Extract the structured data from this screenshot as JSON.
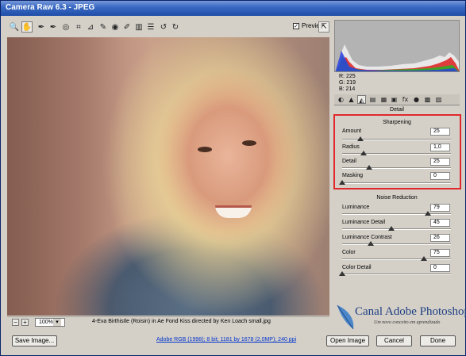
{
  "window": {
    "title": "Camera Raw 6.3  -  JPEG"
  },
  "toolbar": {
    "tools": [
      {
        "name": "zoom-tool-icon",
        "glyph": "🔍"
      },
      {
        "name": "hand-tool-icon",
        "glyph": "✋"
      },
      {
        "name": "white-balance-tool-icon",
        "glyph": "✒"
      },
      {
        "name": "color-sampler-tool-icon",
        "glyph": "✒"
      },
      {
        "name": "targeted-adjustment-tool-icon",
        "glyph": "◎"
      },
      {
        "name": "crop-tool-icon",
        "glyph": "⌗"
      },
      {
        "name": "straighten-tool-icon",
        "glyph": "⊿"
      },
      {
        "name": "spot-removal-tool-icon",
        "glyph": "✎"
      },
      {
        "name": "red-eye-tool-icon",
        "glyph": "◉"
      },
      {
        "name": "adjustment-brush-icon",
        "glyph": "✐"
      },
      {
        "name": "graduated-filter-icon",
        "glyph": "▥"
      },
      {
        "name": "preferences-icon",
        "glyph": "☰"
      },
      {
        "name": "rotate-left-icon",
        "glyph": "↺"
      },
      {
        "name": "rotate-right-icon",
        "glyph": "↻"
      }
    ],
    "preview_label": "Preview",
    "preview_checked": "✓",
    "fullscreen_glyph": "⇱"
  },
  "status": {
    "zoom_out_glyph": "−",
    "zoom_in_glyph": "+",
    "zoom": "100%",
    "zoom_drop_glyph": "▾",
    "filename": "4-Eva Birthistle (Roisin) in Ae Fond Kiss directed by Ken Loach small.jpg"
  },
  "readout": {
    "r": "R:  225",
    "g": "G:  219",
    "b": "B:  214"
  },
  "panel": {
    "title": "Detail",
    "tabs": [
      "◐",
      "▲",
      "◭",
      "▤",
      "▦",
      "▣",
      "fx",
      "●",
      "▩",
      "▨"
    ],
    "sharpening": {
      "title": "Sharpening",
      "sliders": [
        {
          "label": "Amount",
          "value": "25",
          "fraction": 0.17
        },
        {
          "label": "Radius",
          "value": "1,0",
          "fraction": 0.2
        },
        {
          "label": "Detail",
          "value": "25",
          "fraction": 0.25
        },
        {
          "label": "Masking",
          "value": "0",
          "fraction": 0.0
        }
      ]
    },
    "noise": {
      "title": "Noise Reduction",
      "sliders": [
        {
          "label": "Luminance",
          "value": "79",
          "fraction": 0.79
        },
        {
          "label": "Luminance Detail",
          "value": "45",
          "fraction": 0.45
        },
        {
          "label": "Luminance Contrast",
          "value": "26",
          "fraction": 0.26
        },
        {
          "label": "Color",
          "value": "75",
          "fraction": 0.75
        },
        {
          "label": "Color Detail",
          "value": "0",
          "fraction": 0.0
        }
      ]
    }
  },
  "logo": {
    "title": "Canal Adobe Photoshop",
    "tagline": "Um novo conceito em aprendizado"
  },
  "buttons": {
    "save": "Save Image...",
    "colorspace": "Adobe RGB (1998); 8 bit; 1181 by 1678 (2,0MP); 240 ppi",
    "open": "Open Image",
    "cancel": "Cancel",
    "done": "Done"
  },
  "colors": {
    "highlight_box": "#e0282c",
    "titlebar": "#1f4ea8",
    "link": "#0033cc"
  }
}
